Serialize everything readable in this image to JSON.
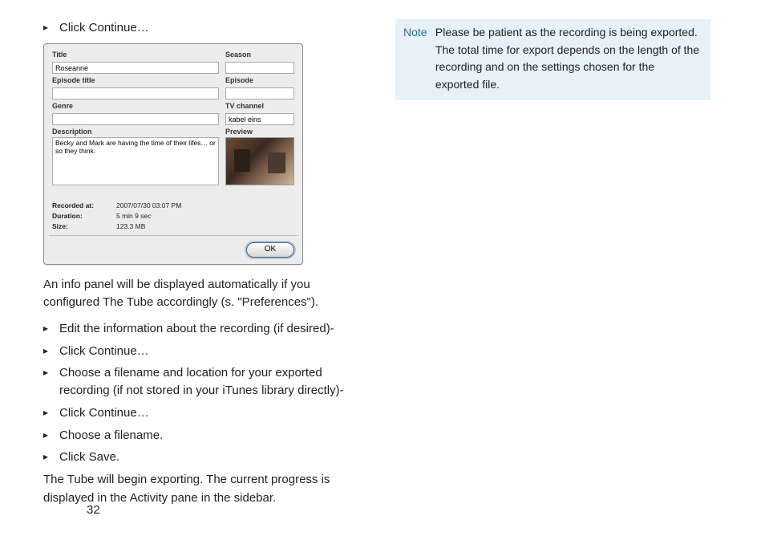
{
  "left": {
    "b1": "Click Continue…",
    "dialog": {
      "title_label": "Title",
      "title_value": "Roseanne",
      "season_label": "Season",
      "season_value": "",
      "eptitle_label": "Episode title",
      "eptitle_value": "",
      "episode_label": "Episode",
      "episode_value": "",
      "genre_label": "Genre",
      "genre_value": "",
      "tvch_label": "TV channel",
      "tvch_value": "kabel eins",
      "desc_label": "Description",
      "desc_value": "Becky and Mark are having the time of their lifes… or so they think.",
      "preview_label": "Preview",
      "recorded_label": "Recorded at:",
      "recorded_value": "2007/07/30 03:07 PM",
      "duration_label": "Duration:",
      "duration_value": "5 min 9 sec",
      "size_label": "Size:",
      "size_value": "123.3 MB",
      "ok": "OK"
    },
    "p1": "An info panel will be displayed automatically if you configured The Tube accordingly (s. \"Preferences\").",
    "b2": "Edit the information about the recording (if desired)-",
    "b3": "Click Continue…",
    "b4": "Choose a filename and location for your exported recording (if not stored in your iTunes library directly)-",
    "b5": "Click Continue…",
    "b6": "Choose a filename.",
    "b7": "Click Save.",
    "p2": "The Tube will begin exporting. The current progress is displayed in the Activity pane in the sidebar.",
    "page_num": "32"
  },
  "right": {
    "note_label": "Note",
    "note_text": "Please be patient as the recording is being exported. The total time for export depends on the  length of the recording and on the settings chosen for the exported file."
  }
}
